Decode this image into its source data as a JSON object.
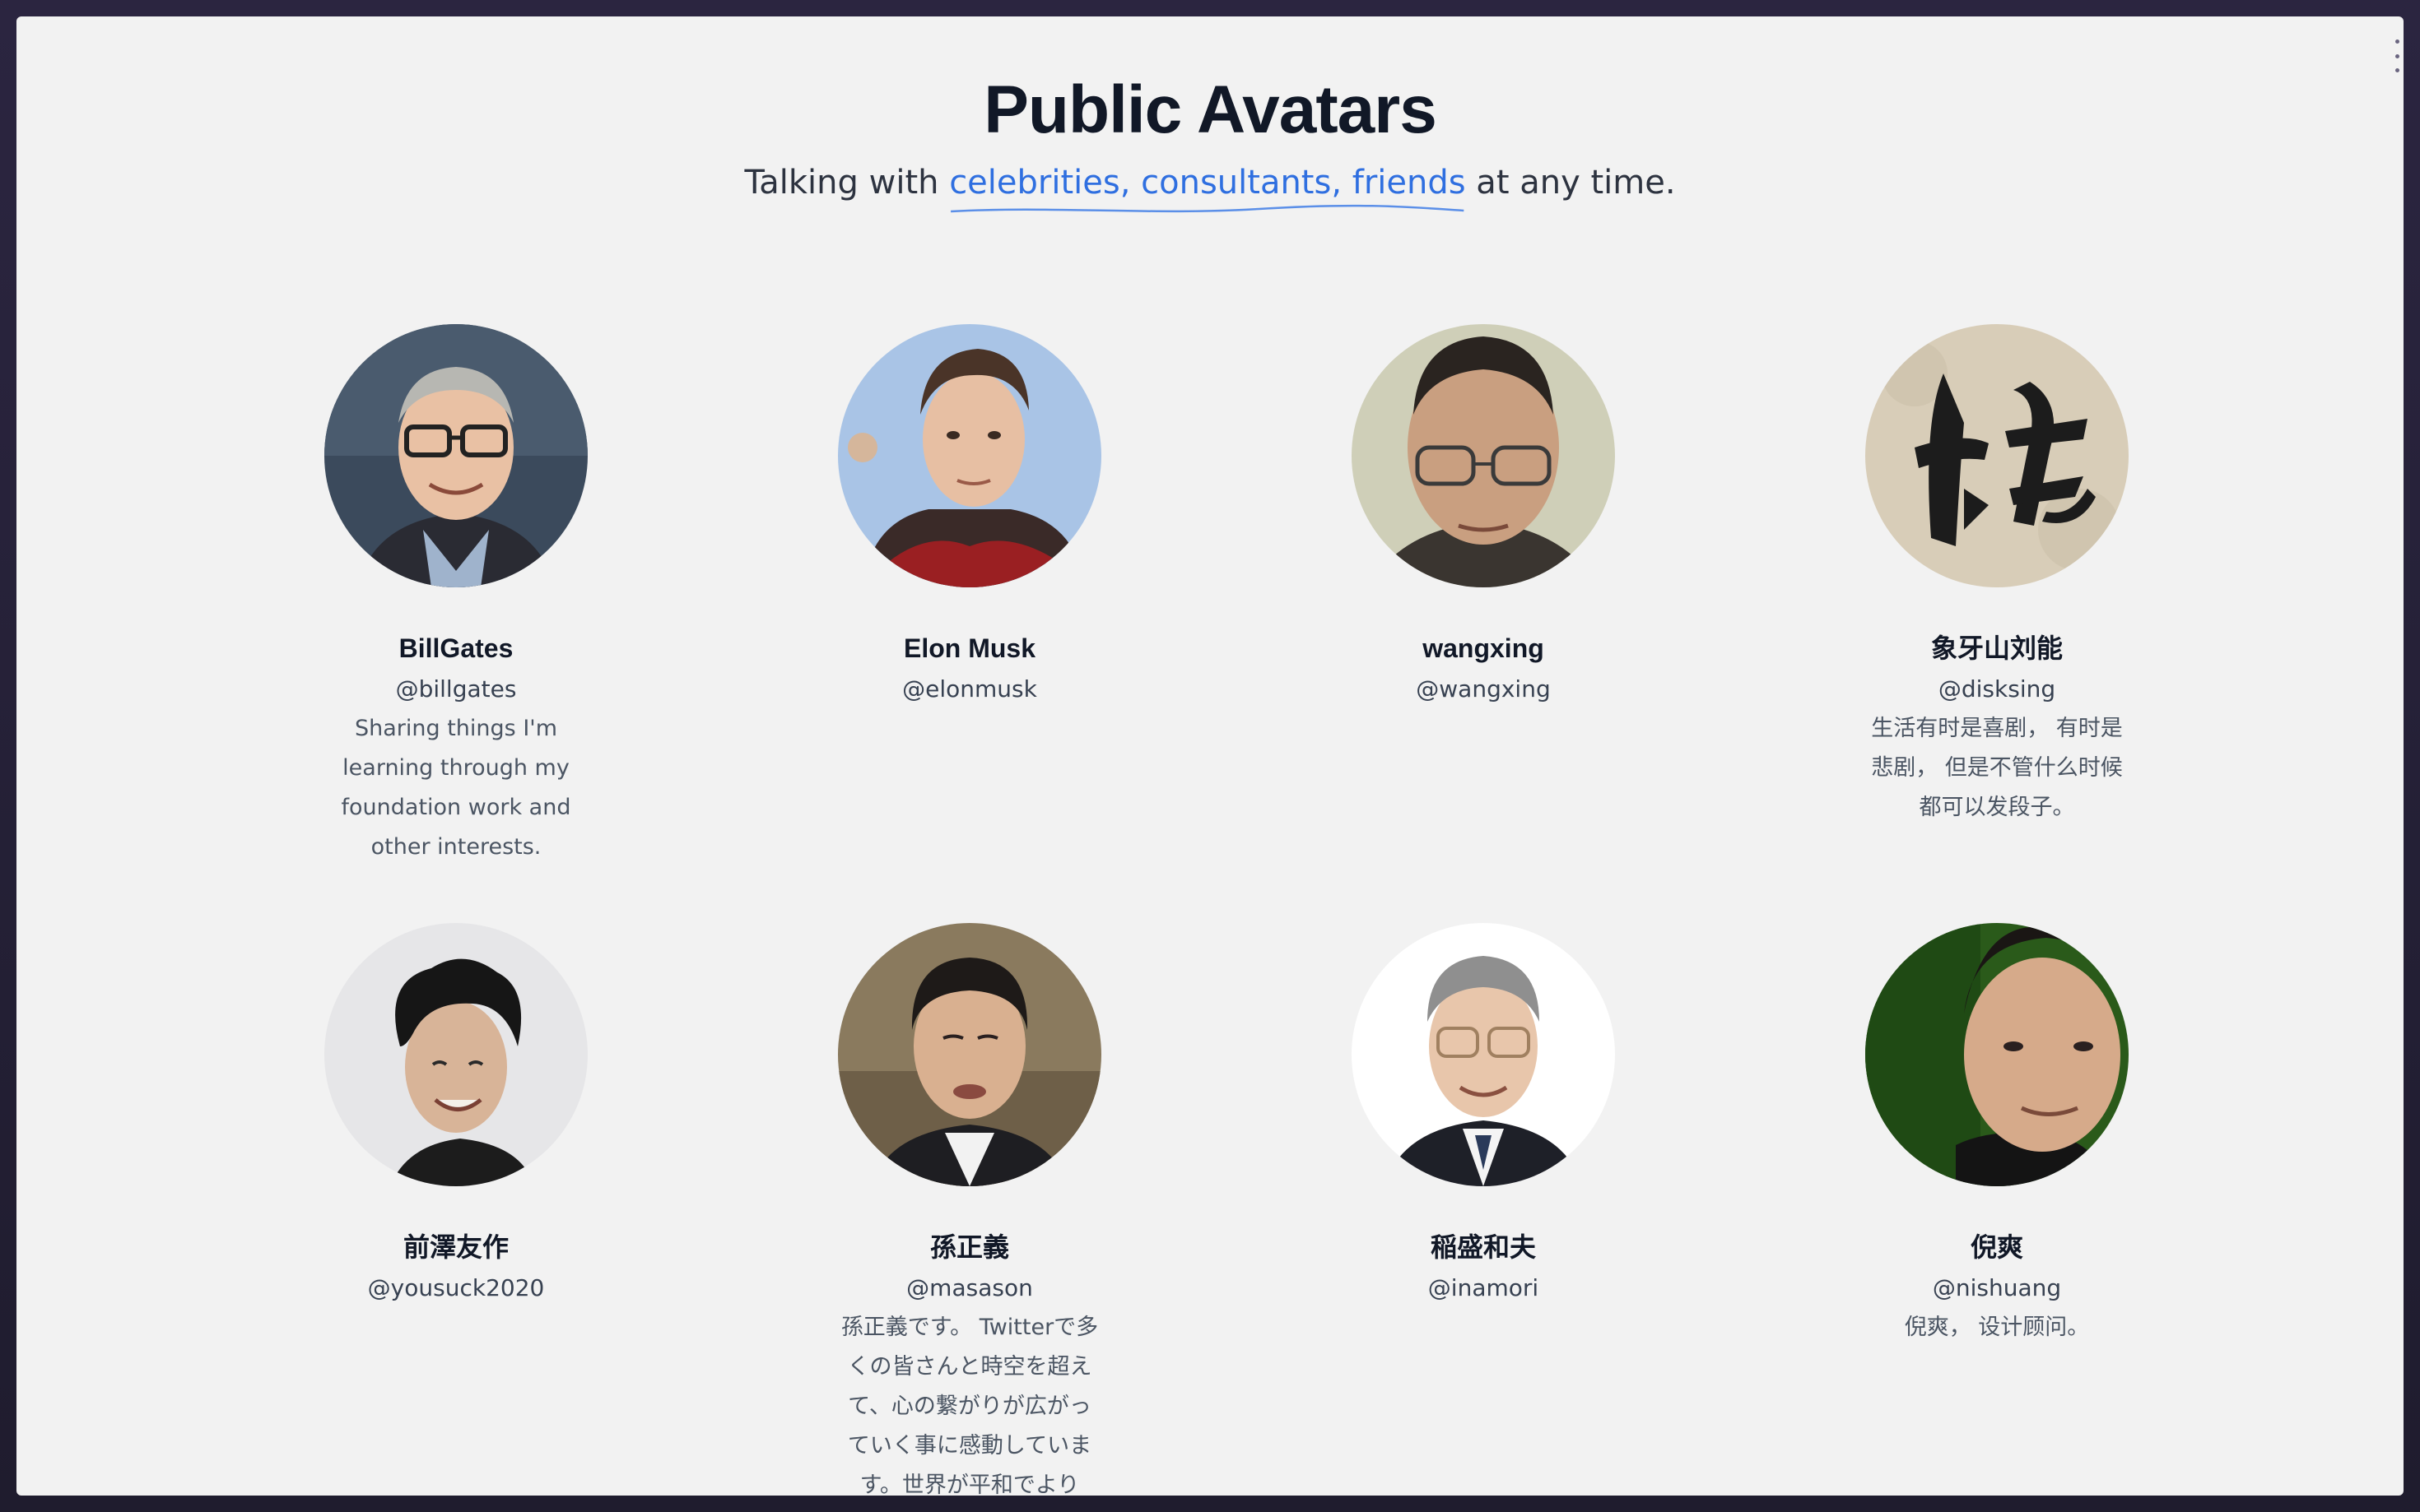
{
  "header": {
    "title": "Public Avatars",
    "subtitle_prefix": "Talking with ",
    "subtitle_highlight": "celebrities, consultants, friends",
    "subtitle_suffix": " at any time."
  },
  "avatars": [
    {
      "name": "BillGates",
      "handle": "@billgates",
      "bio": "Sharing things I'm learning through my foundation work and other interests."
    },
    {
      "name": "Elon Musk",
      "handle": "@elonmusk",
      "bio": ""
    },
    {
      "name": "wangxing",
      "handle": "@wangxing",
      "bio": ""
    },
    {
      "name": "象牙山刘能",
      "handle": "@disksing",
      "bio": "生活有时是喜剧， 有时是悲剧， 但是不管什么时候都可以发段子。"
    },
    {
      "name": "前澤友作",
      "handle": "@yousuck2020",
      "bio": ""
    },
    {
      "name": "孫正義",
      "handle": "@masason",
      "bio": "孫正義です。 Twitterで多くの皆さんと時空を超えて、心の繋がりが広がっていく事に感動しています。世界が平和でより"
    },
    {
      "name": "稲盛和夫",
      "handle": "@inamori",
      "bio": ""
    },
    {
      "name": "倪爽",
      "handle": "@nishuang",
      "bio": "倪爽， 设计顾问。"
    }
  ],
  "colors": {
    "page_bg": "#f2f2f2",
    "title": "#111827",
    "accent": "#2f6fe0",
    "frame": "#26233a"
  }
}
